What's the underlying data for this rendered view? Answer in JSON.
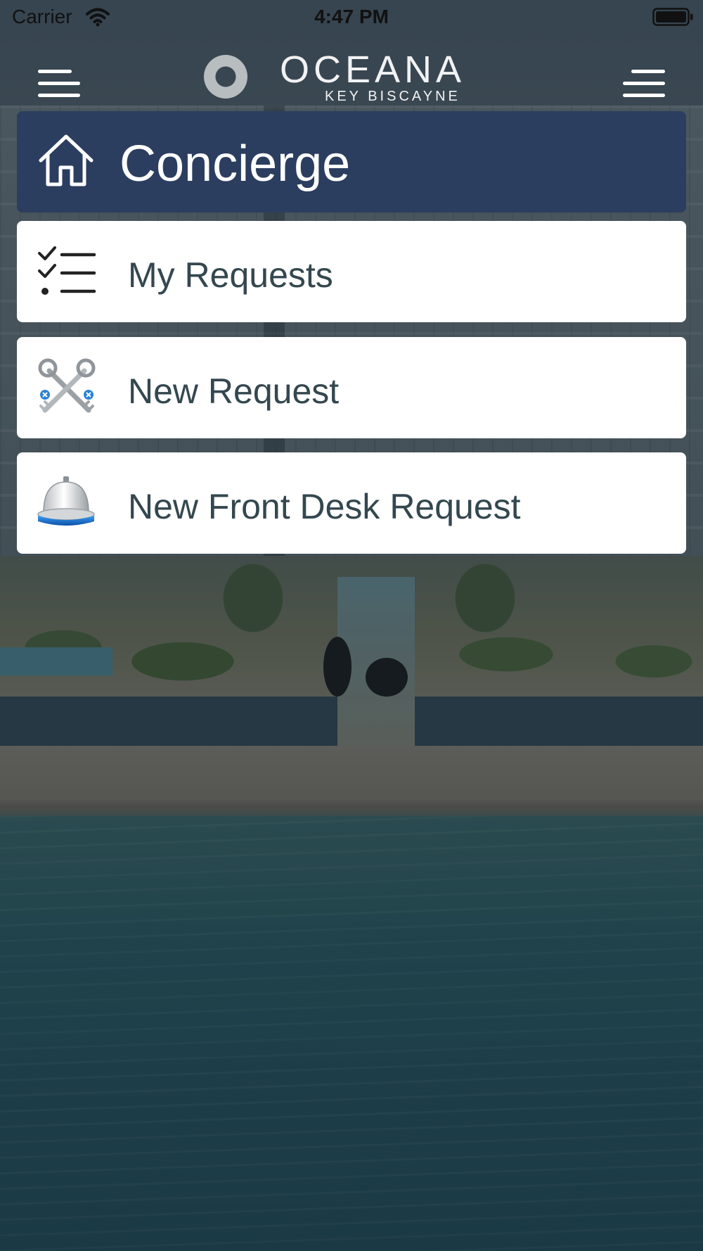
{
  "status_bar": {
    "carrier": "Carrier",
    "time": "4:47 PM",
    "icons": [
      "wifi-icon",
      "battery-icon"
    ]
  },
  "nav": {
    "left_menu_icon": "hamburger-menu-icon",
    "right_menu_icon": "hamburger-menu-icon",
    "logo": {
      "name": "OCEANA",
      "subtitle": "KEY BISCAYNE"
    }
  },
  "header": {
    "icon": "home-icon",
    "title": "Concierge",
    "background_color": "#2c3e5f"
  },
  "menu": {
    "items": [
      {
        "label": "My Requests",
        "icon": "checklist-icon"
      },
      {
        "label": "New Request",
        "icon": "crossed-keys-icon"
      },
      {
        "label": "New Front Desk Request",
        "icon": "service-bell-icon"
      }
    ]
  },
  "colors": {
    "card_background": "#ffffff",
    "card_text": "#34474f",
    "header_background": "#2c3e5f"
  }
}
